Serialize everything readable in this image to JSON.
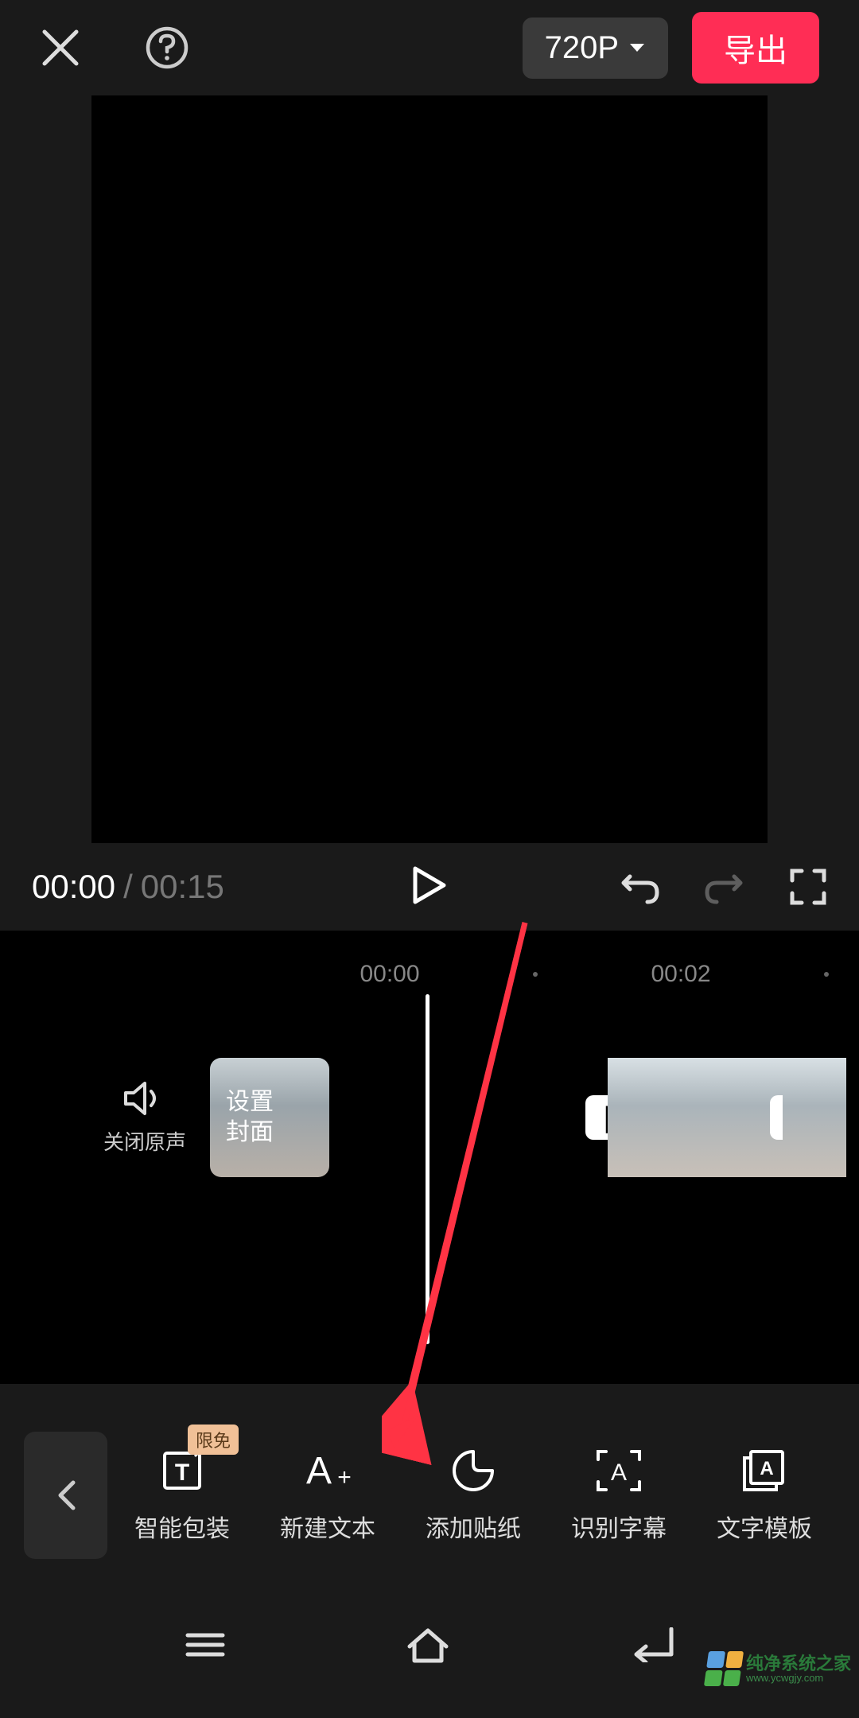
{
  "top": {
    "resolution": "720P",
    "export": "导出"
  },
  "playback": {
    "current": "00:00",
    "separator": "/",
    "total": "00:15"
  },
  "ruler": {
    "t0": "00:00",
    "t1": "00:02"
  },
  "track": {
    "mute": "关闭原声",
    "cover_l1": "设置",
    "cover_l2": "封面",
    "split": "|",
    "add": "+"
  },
  "tools": {
    "badge": "限免",
    "items": [
      {
        "label": "智能包装"
      },
      {
        "label": "新建文本"
      },
      {
        "label": "添加贴纸"
      },
      {
        "label": "识别字幕"
      },
      {
        "label": "文字模板"
      }
    ]
  },
  "watermark": {
    "main": "纯净系统之家",
    "sub": "www.ycwgjy.com"
  }
}
